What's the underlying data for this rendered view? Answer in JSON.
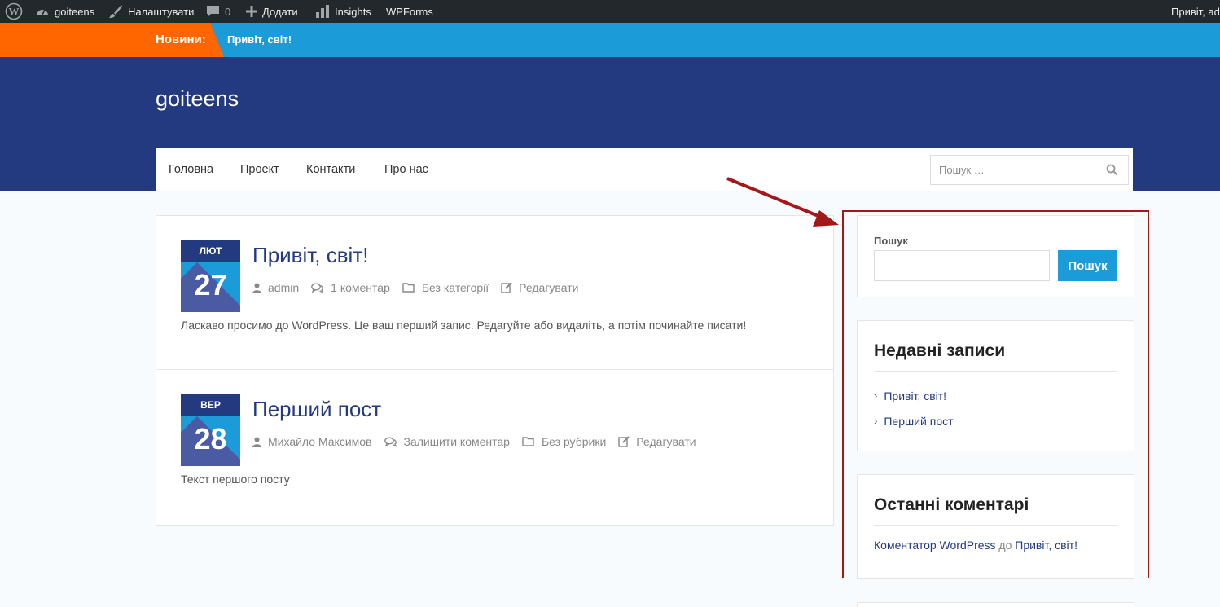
{
  "admin_bar": {
    "wp_logo_icon": "wordpress-icon",
    "site_name": "goiteens",
    "customize_label": "Налаштувати",
    "comments_count": "0",
    "new_label": "Додати",
    "insights_label": "Insights",
    "wpforms_label": "WPForms",
    "greeting": "Привіт, ad"
  },
  "ticker": {
    "label": "Новини:",
    "text": "Привіт, світ!",
    "label_color": "#ff6600",
    "bg_color": "#1b9bd7"
  },
  "header": {
    "site_title": "goiteens",
    "bg_color": "#233a80"
  },
  "nav": {
    "items": [
      "Головна",
      "Проект",
      "Контакти",
      "Про нас"
    ],
    "search_placeholder": "Пошук …"
  },
  "posts": [
    {
      "month": "ЛЮТ",
      "day": "27",
      "title": "Привіт, світ!",
      "author": "admin",
      "comments": "1 коментар",
      "category": "Без категорії",
      "edit": "Редагувати",
      "excerpt": "Ласкаво просимо до WordPress. Це ваш перший запис. Редагуйте або видаліть, а потім починайте писати!"
    },
    {
      "month": "ВЕР",
      "day": "28",
      "title": "Перший пост",
      "author": "Михайло Максимов",
      "comments": "Залишити коментар",
      "category": "Без рубрики",
      "edit": "Редагувати",
      "excerpt": "Текст першого посту"
    }
  ],
  "sidebar": {
    "search": {
      "label": "Пошук",
      "button": "Пошук"
    },
    "recent_posts": {
      "title": "Недавні записи",
      "items": [
        "Привіт, світ!",
        "Перший пост"
      ]
    },
    "recent_comments": {
      "title": "Останні коментарі",
      "author": "Коментатор WordPress",
      "connector": "до",
      "post": "Привіт, світ!"
    }
  },
  "annotation": {
    "color": "#a31919"
  }
}
